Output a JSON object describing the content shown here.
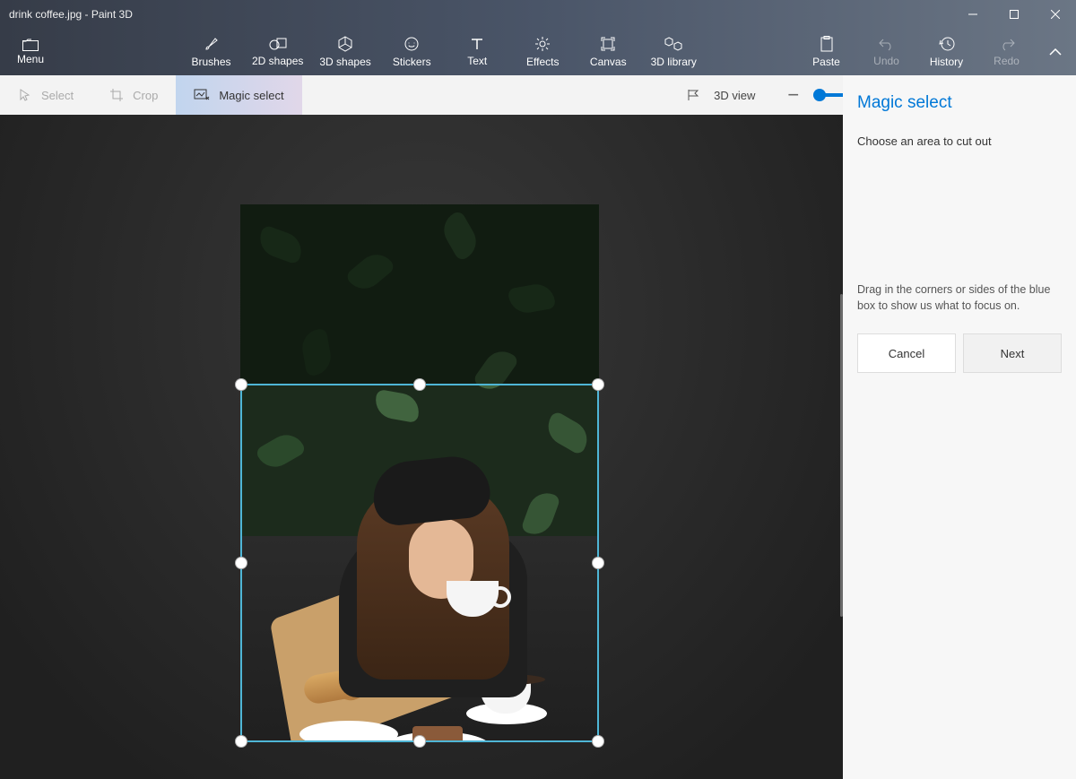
{
  "title": "drink coffee.jpg - Paint 3D",
  "menu": {
    "label": "Menu"
  },
  "ribbon": {
    "brushes": "Brushes",
    "shapes2d": "2D shapes",
    "shapes3d": "3D shapes",
    "stickers": "Stickers",
    "text": "Text",
    "effects": "Effects",
    "canvas": "Canvas",
    "library3d": "3D library",
    "paste": "Paste",
    "undo": "Undo",
    "history": "History",
    "redo": "Redo"
  },
  "toolbar": {
    "select": "Select",
    "crop": "Crop",
    "magic_select": "Magic select",
    "view3d": "3D view",
    "zoom_percent": "10%"
  },
  "panel": {
    "title": "Magic select",
    "subtitle": "Choose an area to cut out",
    "help": "Drag in the corners or sides of the blue box to show us what to focus on.",
    "cancel": "Cancel",
    "next": "Next"
  }
}
